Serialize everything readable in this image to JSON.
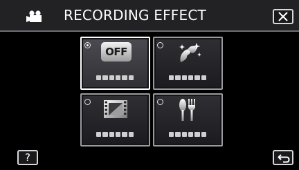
{
  "header": {
    "mode_icon": "movie-camera-icon",
    "title": "RECORDING EFFECT",
    "close_icon": "close-icon"
  },
  "tiles": [
    {
      "icon": "off-icon",
      "icon_text": "OFF",
      "selected": true,
      "label": "▬▬▬▬▬▬"
    },
    {
      "icon": "skin-beautify-icon",
      "selected": false,
      "label": "▬▬▬▬▬▬"
    },
    {
      "icon": "film-icon",
      "selected": false,
      "label": "▬▬▬▬▬▬"
    },
    {
      "icon": "food-icon",
      "selected": false,
      "label": "▬▬▬▬▬▬"
    }
  ],
  "footer": {
    "help_label": "?",
    "back_icon": "back-arrow-icon"
  },
  "colors": {
    "header_bg": "#222225",
    "tile_border": "#9a9aa0",
    "selected_border": "#ffffff"
  }
}
